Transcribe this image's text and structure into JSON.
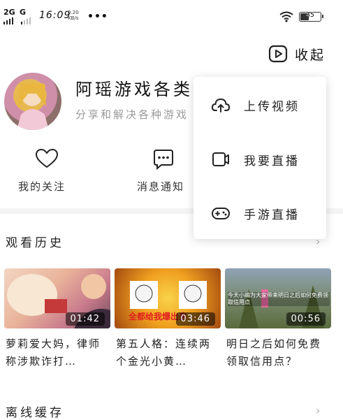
{
  "status_bar": {
    "network_1": "2G",
    "network_2": "G",
    "time": "16:09",
    "speed_value": "0.20",
    "speed_unit": "KB/s",
    "more_dots": "•••",
    "battery_level": "45",
    "battery_fraction": 0.45
  },
  "header": {
    "collapse_label": "收起"
  },
  "profile": {
    "name": "阿瑶游戏各类",
    "bio": "分享和解决各种游戏"
  },
  "quick_actions": [
    {
      "label": "我的关注",
      "icon": "heart-icon"
    },
    {
      "label": "消息通知",
      "icon": "message-icon"
    }
  ],
  "history": {
    "title": "观看历史",
    "videos": [
      {
        "duration": "01:42",
        "title": "萝莉爱大妈，律师称涉欺诈打…"
      },
      {
        "duration": "03:46",
        "title": "第五人格：连续两个金光小黄…",
        "overlay_text": "全都给我爆出来"
      },
      {
        "duration": "00:56",
        "title": "明日之后如何免费领取信用点？",
        "overlay_text": "今天小编为大家带来明日之后如何免费领取信用点"
      }
    ]
  },
  "next_section": {
    "title": "离线缓存"
  },
  "popup_menu": {
    "items": [
      {
        "label": "上传视频",
        "icon": "upload-cloud-icon"
      },
      {
        "label": "我要直播",
        "icon": "camera-icon"
      },
      {
        "label": "手游直播",
        "icon": "gamepad-icon"
      }
    ]
  },
  "colors": {
    "accent_orange": "#f5a623",
    "text": "#222222",
    "muted": "#9a9a9a"
  }
}
